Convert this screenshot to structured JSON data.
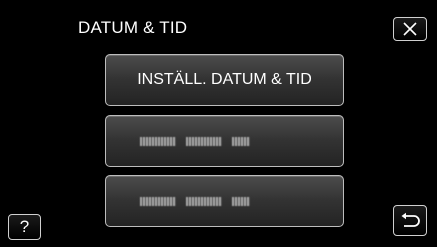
{
  "header": {
    "title": "DATUM & TID",
    "close_icon": "close-x-icon"
  },
  "menu": {
    "items": [
      {
        "label": "INSTÄLL. DATUM & TID",
        "state": "readable"
      },
      {
        "label": "",
        "state": "blurred-placeholder"
      },
      {
        "label": "",
        "state": "blurred-placeholder"
      }
    ]
  },
  "footer": {
    "help_label": "?",
    "back_icon": "return-arrow-icon"
  },
  "colors": {
    "background": "#000000",
    "text": "#ffffff",
    "button_border": "#bdbdbd",
    "button_fill_top": "#4c4c4c",
    "button_fill_bottom": "#232323"
  }
}
